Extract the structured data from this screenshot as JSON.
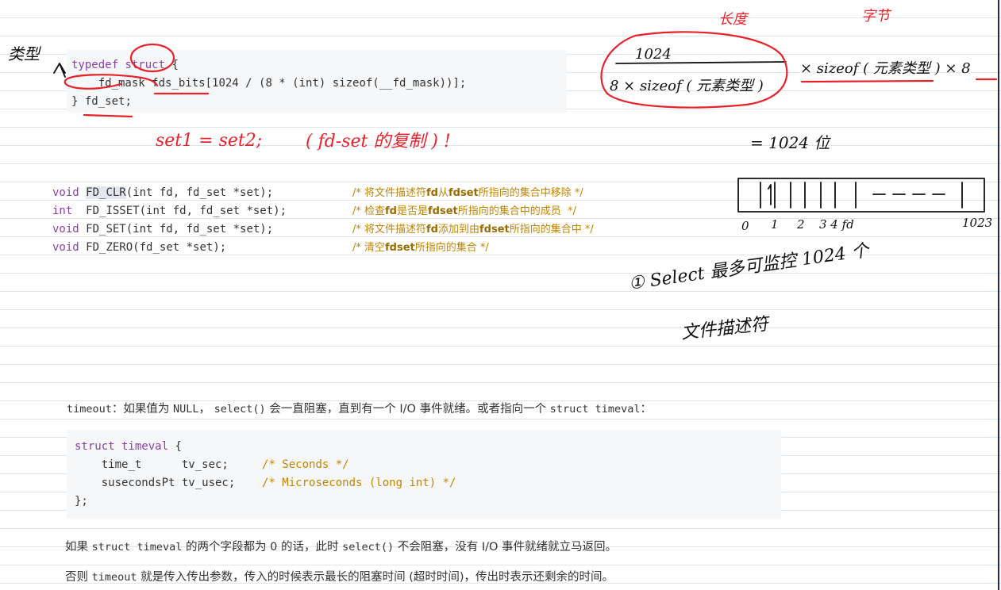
{
  "fdset_code": {
    "line1_kw1": "typedef",
    "line1_kw2": "struct",
    "line1_rest": " {",
    "line2_type": "__fd_mask",
    "line2_field": "fds_bits",
    "line2_rest": "[1024 / (8 * (int) sizeof(__fd_mask))];",
    "line3_brace": "} ",
    "line3_name": "fd_set",
    "line3_end": ";"
  },
  "macro_code": [
    {
      "ret": "void",
      "name": "FD_CLR",
      "args": "(int fd, fd_set *set);",
      "c1": "/* ",
      "c2": "将文件描述符",
      "c3": "fd",
      "c4": "从",
      "c5": "fdset",
      "c6": "所指向的集合中移除 */"
    },
    {
      "ret": "int ",
      "name": "FD_ISSET",
      "args": "(int fd, fd_set *set);",
      "c1": "/* ",
      "c2": "检查",
      "c3": "fd",
      "c4": "是否是",
      "c5": "fdset",
      "c6": "所指向的集合中的成员  */"
    },
    {
      "ret": "void",
      "name": "FD_SET",
      "args": "(int fd, fd_set *set);",
      "c1": "/* ",
      "c2": "将文件描述符",
      "c3": "fd",
      "c4": "添加到由",
      "c5": "fdset",
      "c6": "所指向的集合中 */"
    },
    {
      "ret": "void",
      "name": "FD_ZERO",
      "args": "(fd_set *set);",
      "c1": "/* ",
      "c2": "清空",
      "c3": "fdset",
      "c4": "所指向的集合 */",
      "c5": "",
      "c6": ""
    }
  ],
  "timeout_text": {
    "code1": "timeout",
    "t1": "：如果值为 ",
    "code2": "NULL",
    "t2": "， ",
    "code3": "select()",
    "t3": " 会一直阻塞，直到有一个 I/O 事件就绪。或者指向一个 ",
    "code4": "struct timeval",
    "t4": "："
  },
  "timeval_code": {
    "l1_kw": "struct",
    "l1_name": " timeval",
    "l1_end": " {",
    "l2": "    time_t      tv_sec;     ",
    "l2_c": "/* Seconds */",
    "l3": "    susecondsPt tv_usec;    ",
    "l3_c": "/* Microseconds (long int) */",
    "l4": "};"
  },
  "para1": {
    "t1": "如果 ",
    "code1": "struct timeval",
    "t2": " 的两个字段都为 0 的话，此时 ",
    "code2": "select()",
    "t3": " 不会阻塞，没有 I/O 事件就绪就立马返回。"
  },
  "para2": {
    "t1": "否则 ",
    "code1": "timeout",
    "t2": " 就是传入传出参数，传入的时候表示最长的阻塞时间 (超时时间)，传出时表示还剩余的时间。"
  },
  "handwriting": {
    "type_note": "类型",
    "assign_note": "set1 = set2;",
    "copy_note": "( fd-set 的复制 ) !",
    "length_note": "长度",
    "byte_note": "字节",
    "numerator": "1024",
    "denominator": "8 × sizeof ( 元素类型 )",
    "times_sizeof": "× sizeof ( 元素类型 ) × 8",
    "equals_bits": "= 1024 位",
    "idx0": "0",
    "idx1": "1",
    "idx2": "2",
    "idx34": "3 4 fd",
    "idx_last": "1023",
    "select_note_line1": "① Select 最多可监控 1024 个",
    "select_note_line2": "文件描述符"
  }
}
